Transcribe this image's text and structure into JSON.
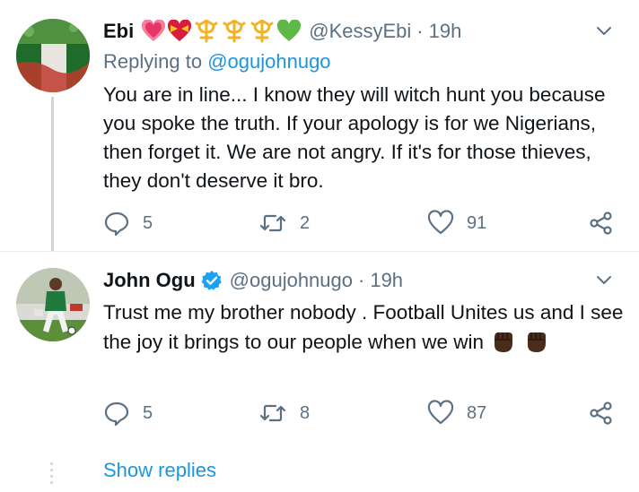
{
  "tweets": [
    {
      "name": "Ebi",
      "name_emojis": [
        "sparkling-heart",
        "heart-with-ribbon",
        "trident-emblem",
        "trident-emblem",
        "trident-emblem",
        "green-heart"
      ],
      "handle": "@KessyEbi",
      "separator": "·",
      "time": "19h",
      "replying_prefix": "Replying to",
      "replying_to": "@ogujohnugo",
      "text": "You are in line...  I know they will witch hunt you because you spoke the truth.  If your apology is for we Nigerians,  then forget it.  We are not angry.  If it's for those thieves, they don't deserve it bro.",
      "replies": "5",
      "retweets": "2",
      "likes": "91"
    },
    {
      "name": "John Ogu",
      "verified": true,
      "handle": "@ogujohnugo",
      "separator": "·",
      "time": "19h",
      "text": "Trust me my brother nobody . Football Unites us and I see the joy it brings to our people when we win",
      "text_emojis": [
        "raised-fist-dark",
        "raised-fist-dark"
      ],
      "replies": "5",
      "retweets": "8",
      "likes": "87"
    }
  ],
  "show_replies": "Show replies",
  "colors": {
    "link": "#1b95e0",
    "muted": "#5b7083",
    "divider": "#e6ecf0",
    "thread_line": "#ccd6dd",
    "verified": "#1da1f2"
  }
}
